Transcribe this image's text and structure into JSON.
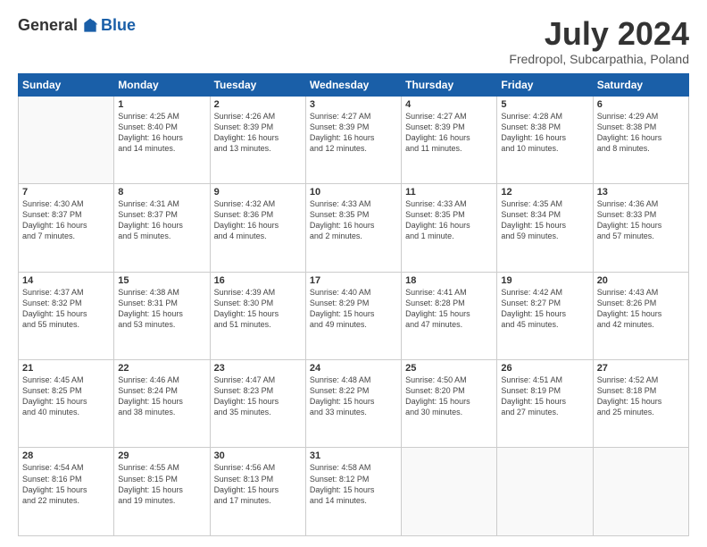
{
  "logo": {
    "general": "General",
    "blue": "Blue"
  },
  "title": "July 2024",
  "subtitle": "Fredropol, Subcarpathia, Poland",
  "weekdays": [
    "Sunday",
    "Monday",
    "Tuesday",
    "Wednesday",
    "Thursday",
    "Friday",
    "Saturday"
  ],
  "weeks": [
    [
      {
        "day": "",
        "info": ""
      },
      {
        "day": "1",
        "info": "Sunrise: 4:25 AM\nSunset: 8:40 PM\nDaylight: 16 hours\nand 14 minutes."
      },
      {
        "day": "2",
        "info": "Sunrise: 4:26 AM\nSunset: 8:39 PM\nDaylight: 16 hours\nand 13 minutes."
      },
      {
        "day": "3",
        "info": "Sunrise: 4:27 AM\nSunset: 8:39 PM\nDaylight: 16 hours\nand 12 minutes."
      },
      {
        "day": "4",
        "info": "Sunrise: 4:27 AM\nSunset: 8:39 PM\nDaylight: 16 hours\nand 11 minutes."
      },
      {
        "day": "5",
        "info": "Sunrise: 4:28 AM\nSunset: 8:38 PM\nDaylight: 16 hours\nand 10 minutes."
      },
      {
        "day": "6",
        "info": "Sunrise: 4:29 AM\nSunset: 8:38 PM\nDaylight: 16 hours\nand 8 minutes."
      }
    ],
    [
      {
        "day": "7",
        "info": "Sunrise: 4:30 AM\nSunset: 8:37 PM\nDaylight: 16 hours\nand 7 minutes."
      },
      {
        "day": "8",
        "info": "Sunrise: 4:31 AM\nSunset: 8:37 PM\nDaylight: 16 hours\nand 5 minutes."
      },
      {
        "day": "9",
        "info": "Sunrise: 4:32 AM\nSunset: 8:36 PM\nDaylight: 16 hours\nand 4 minutes."
      },
      {
        "day": "10",
        "info": "Sunrise: 4:33 AM\nSunset: 8:35 PM\nDaylight: 16 hours\nand 2 minutes."
      },
      {
        "day": "11",
        "info": "Sunrise: 4:33 AM\nSunset: 8:35 PM\nDaylight: 16 hours\nand 1 minute."
      },
      {
        "day": "12",
        "info": "Sunrise: 4:35 AM\nSunset: 8:34 PM\nDaylight: 15 hours\nand 59 minutes."
      },
      {
        "day": "13",
        "info": "Sunrise: 4:36 AM\nSunset: 8:33 PM\nDaylight: 15 hours\nand 57 minutes."
      }
    ],
    [
      {
        "day": "14",
        "info": "Sunrise: 4:37 AM\nSunset: 8:32 PM\nDaylight: 15 hours\nand 55 minutes."
      },
      {
        "day": "15",
        "info": "Sunrise: 4:38 AM\nSunset: 8:31 PM\nDaylight: 15 hours\nand 53 minutes."
      },
      {
        "day": "16",
        "info": "Sunrise: 4:39 AM\nSunset: 8:30 PM\nDaylight: 15 hours\nand 51 minutes."
      },
      {
        "day": "17",
        "info": "Sunrise: 4:40 AM\nSunset: 8:29 PM\nDaylight: 15 hours\nand 49 minutes."
      },
      {
        "day": "18",
        "info": "Sunrise: 4:41 AM\nSunset: 8:28 PM\nDaylight: 15 hours\nand 47 minutes."
      },
      {
        "day": "19",
        "info": "Sunrise: 4:42 AM\nSunset: 8:27 PM\nDaylight: 15 hours\nand 45 minutes."
      },
      {
        "day": "20",
        "info": "Sunrise: 4:43 AM\nSunset: 8:26 PM\nDaylight: 15 hours\nand 42 minutes."
      }
    ],
    [
      {
        "day": "21",
        "info": "Sunrise: 4:45 AM\nSunset: 8:25 PM\nDaylight: 15 hours\nand 40 minutes."
      },
      {
        "day": "22",
        "info": "Sunrise: 4:46 AM\nSunset: 8:24 PM\nDaylight: 15 hours\nand 38 minutes."
      },
      {
        "day": "23",
        "info": "Sunrise: 4:47 AM\nSunset: 8:23 PM\nDaylight: 15 hours\nand 35 minutes."
      },
      {
        "day": "24",
        "info": "Sunrise: 4:48 AM\nSunset: 8:22 PM\nDaylight: 15 hours\nand 33 minutes."
      },
      {
        "day": "25",
        "info": "Sunrise: 4:50 AM\nSunset: 8:20 PM\nDaylight: 15 hours\nand 30 minutes."
      },
      {
        "day": "26",
        "info": "Sunrise: 4:51 AM\nSunset: 8:19 PM\nDaylight: 15 hours\nand 27 minutes."
      },
      {
        "day": "27",
        "info": "Sunrise: 4:52 AM\nSunset: 8:18 PM\nDaylight: 15 hours\nand 25 minutes."
      }
    ],
    [
      {
        "day": "28",
        "info": "Sunrise: 4:54 AM\nSunset: 8:16 PM\nDaylight: 15 hours\nand 22 minutes."
      },
      {
        "day": "29",
        "info": "Sunrise: 4:55 AM\nSunset: 8:15 PM\nDaylight: 15 hours\nand 19 minutes."
      },
      {
        "day": "30",
        "info": "Sunrise: 4:56 AM\nSunset: 8:13 PM\nDaylight: 15 hours\nand 17 minutes."
      },
      {
        "day": "31",
        "info": "Sunrise: 4:58 AM\nSunset: 8:12 PM\nDaylight: 15 hours\nand 14 minutes."
      },
      {
        "day": "",
        "info": ""
      },
      {
        "day": "",
        "info": ""
      },
      {
        "day": "",
        "info": ""
      }
    ]
  ]
}
